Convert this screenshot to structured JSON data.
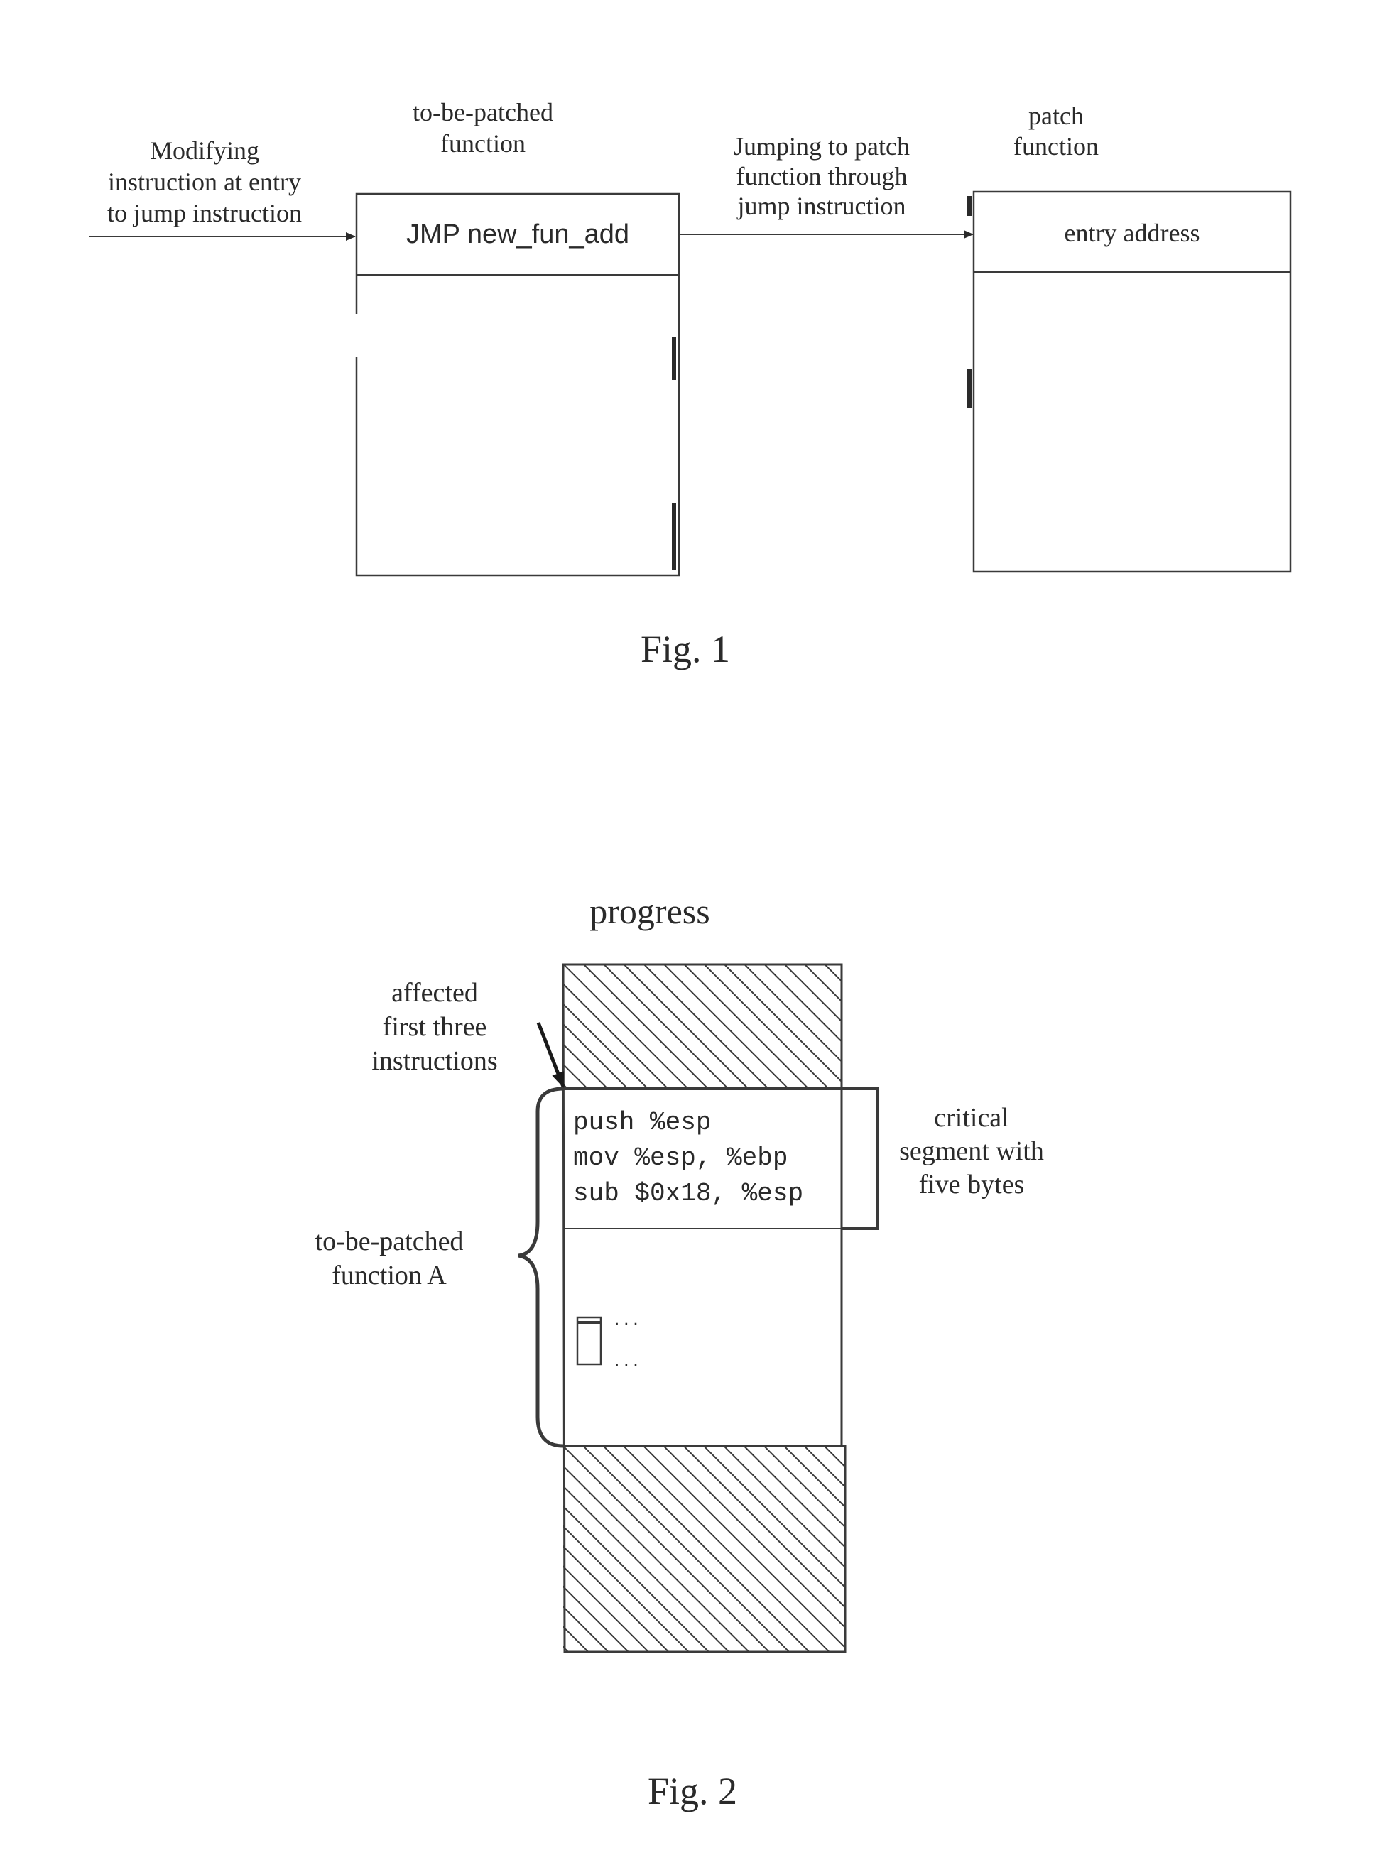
{
  "fig1": {
    "caption": "Fig. 1",
    "left_annotation": [
      "Modifying",
      "instruction at entry",
      "to jump instruction"
    ],
    "to_be_patched_label": [
      "to-be-patched",
      "function"
    ],
    "to_be_patched_entry": "JMP new_fun_add",
    "middle_annotation": [
      "Jumping to patch",
      "function through",
      "jump instruction"
    ],
    "patch_label": [
      "patch",
      "function"
    ],
    "patch_entry": "entry address"
  },
  "fig2": {
    "caption": "Fig. 2",
    "title": "progress",
    "affected_label": [
      "affected",
      "first three",
      "instructions"
    ],
    "instructions": [
      "push %esp",
      "mov %esp, %ebp",
      "sub $0x18, %esp"
    ],
    "critical_label": [
      "critical",
      "segment with",
      "five bytes"
    ],
    "function_label": [
      "to-be-patched",
      "function A"
    ],
    "ellipsis_top": "...",
    "ellipsis_bottom": "..."
  },
  "colors": {
    "ink": "#2a2a2a",
    "background": "#ffffff"
  }
}
